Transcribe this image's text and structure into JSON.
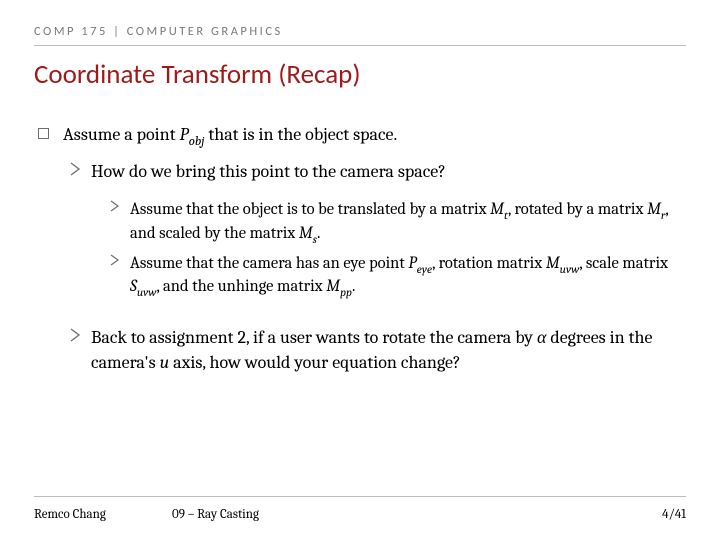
{
  "header": {
    "course_tag": "COMP 175 | COMPUTER GRAPHICS"
  },
  "title": "Coordinate Transform (Recap)",
  "bullets": {
    "lvl1": {
      "pre": "Assume a point ",
      "sym": "P",
      "sub": "obj",
      "post1": " that is in the object space."
    },
    "lvl2a": "How do we bring this point to the camera space?",
    "lvl3a": {
      "pre": "Assume that the object is to be translated by a matrix ",
      "m1": "M",
      "s1": "t",
      "mid1": ", rotated by a matrix ",
      "m2": "M",
      "s2": "r",
      "mid2": ", and scaled by the matrix ",
      "m3": "M",
      "s3": "s",
      "post": "."
    },
    "lvl3b": {
      "pre": "Assume that the camera has an eye point ",
      "p": "P",
      "ps": "eye",
      "mid1": ", rotation matrix ",
      "m": "M",
      "ms": "uvw",
      "mid2": ", scale matrix ",
      "smat": "S",
      "ss": "uvw",
      "mid3": ", and the unhinge matrix ",
      "m2": "M",
      "m2s": "pp",
      "post": "."
    },
    "lvl2b": {
      "pre": "Back to assignment 2, if a user wants to rotate the camera by ",
      "alpha": "α",
      "mid": " degrees in the camera's ",
      "u": "u",
      "post": " axis, how would your equation change?"
    }
  },
  "footer": {
    "author": "Remco Chang",
    "topic": "09 – Ray Casting",
    "page": "4/41"
  }
}
